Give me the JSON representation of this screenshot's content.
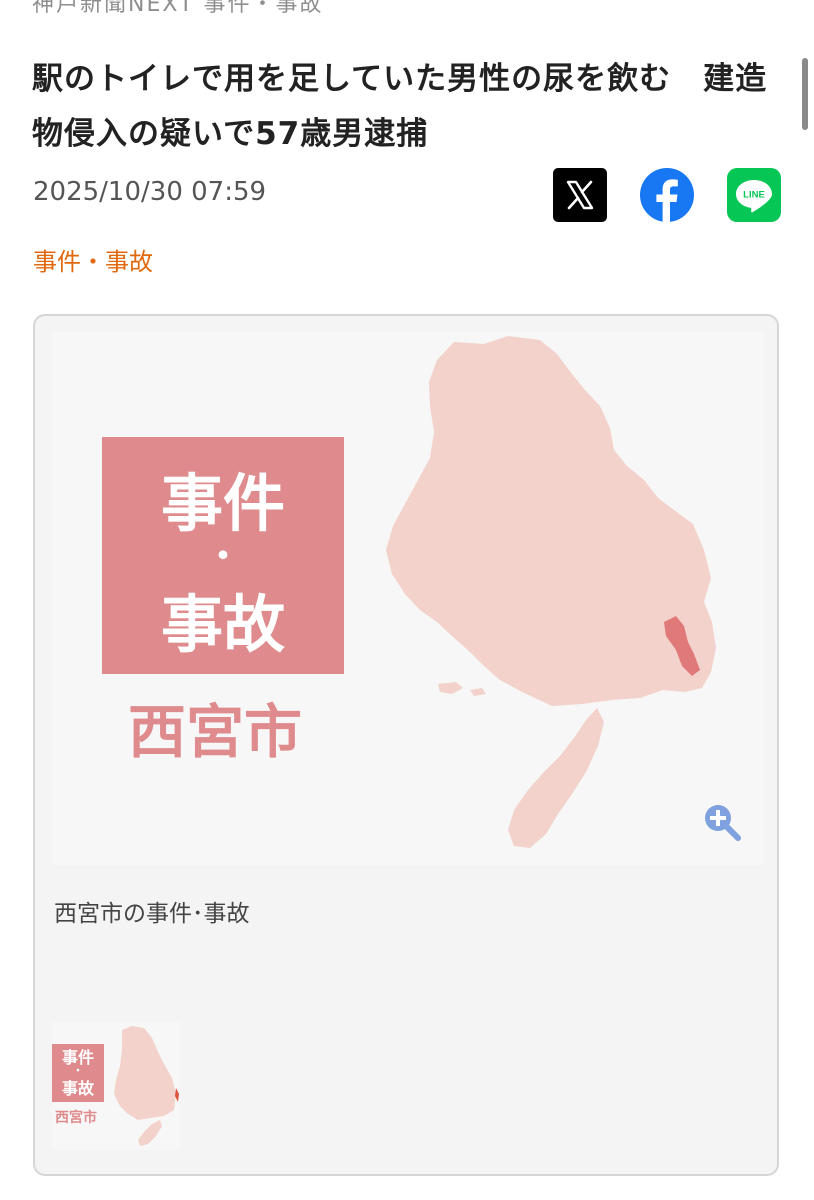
{
  "header": {
    "breadcrumb_partial": "神戸新聞NEXT 事件・事故"
  },
  "article": {
    "title": "駅のトイレで用を足していた男性の尿を飲む　建造物侵入の疑いで57歳男逮捕",
    "date": "2025/10/30 07:59",
    "category": "事件・事故"
  },
  "share": {
    "x_icon": "x-logo-icon",
    "facebook_icon": "facebook-logo-icon",
    "line_icon": "line-logo-icon",
    "line_label": "LINE"
  },
  "image": {
    "label_line1": "事件",
    "label_dot": "・",
    "label_line2": "事故",
    "city": "西宮市",
    "caption": "西宮市の事件･事故",
    "zoom_icon": "zoom-in-icon"
  },
  "thumbnail": {
    "label_line1": "事件",
    "label_dot": "・",
    "label_line2": "事故",
    "city": "西宮市"
  },
  "colors": {
    "accent_category": "#e0690d",
    "label_bg": "#df8b8d",
    "map_fill": "#f2d2ca",
    "highlight": "#e07a7a",
    "line_green": "#06c755",
    "facebook_blue": "#1877f2"
  }
}
